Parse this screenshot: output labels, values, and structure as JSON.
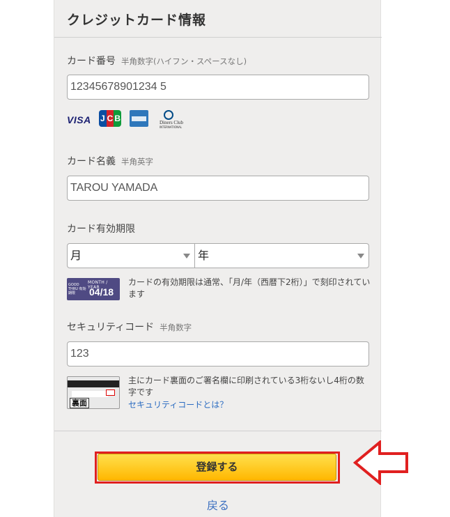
{
  "header": {
    "title": "クレジットカード情報"
  },
  "card_number": {
    "label": "カード番号",
    "hint": "半角数字(ハイフン・スペースなし)",
    "value": "12345678901234 5"
  },
  "brands": {
    "visa": "VISA",
    "jcb": [
      "J",
      "C",
      "B"
    ],
    "diners_name": "Diners Club",
    "diners_sub": "INTERNATIONAL"
  },
  "card_name": {
    "label": "カード名義",
    "hint": "半角英字",
    "value": "TAROU YAMADA"
  },
  "expiry": {
    "label": "カード有効期限",
    "month_selected": "月",
    "year_selected": "年",
    "card_top": "MONTH / YEAR",
    "card_left": "GOOD THRU 有効期限",
    "card_date": "04/18",
    "note": "カードの有効期限は通常、「月/年（西暦下2桁）」で刻印されています"
  },
  "security": {
    "label": "セキュリティコード",
    "hint": "半角数字",
    "value": "123",
    "card_badge": "裏面",
    "note": "主にカード裏面のご署名欄に印刷されている3桁ないし4桁の数字です",
    "link": "セキュリティコードとは？"
  },
  "actions": {
    "submit": "登録する",
    "back": "戻る"
  },
  "colors": {
    "accent": "#ffc400",
    "highlight": "#e02020",
    "link": "#2a6bc1"
  },
  "icons": [
    "visa-logo",
    "jcb-logo",
    "amex-logo",
    "diners-club-logo",
    "expiry-card-icon",
    "card-back-icon",
    "left-arrow-icon",
    "chevron-down-icon"
  ]
}
